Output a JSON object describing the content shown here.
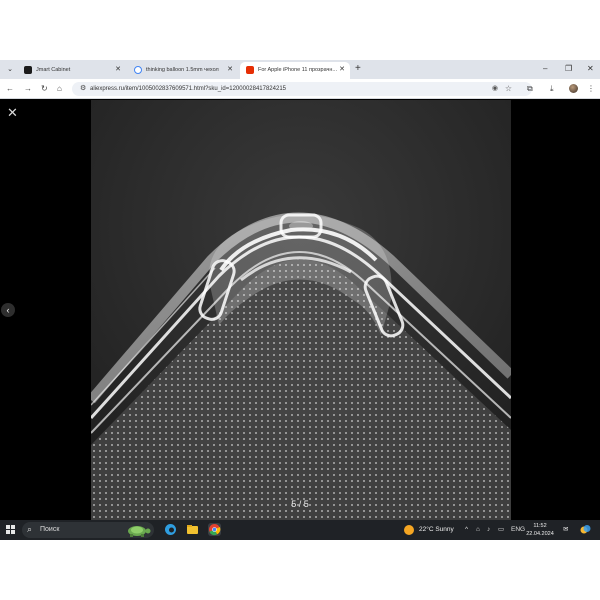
{
  "browser": {
    "tabs": [
      {
        "title": "Jmart Cabinet",
        "favicon_color": "#1b1b1b",
        "active": false
      },
      {
        "title": "thinking balloon 1.5mm чехол",
        "favicon_color": "#4285f4",
        "active": false
      },
      {
        "title": "For Apple iPhone 11 прозрачн...",
        "favicon_color": "#e62e04",
        "active": true
      }
    ],
    "new_tab_glyph": "+",
    "window_controls": {
      "minimize": "–",
      "restore": "❐",
      "close": "✕"
    },
    "url": "aliexpress.ru/item/1005002837609571.html?sku_id=12000028417824215"
  },
  "viewer": {
    "close_glyph": "✕",
    "prev_glyph": "‹",
    "counter": "5 / 5",
    "product_image": "clear silicone phone case corner, dotted back, black background"
  },
  "taskbar": {
    "search_placeholder": "Поиск",
    "weather": "22°C  Sunny",
    "language": "ENG",
    "time": "11:52",
    "date": "22.04.2024",
    "apps": [
      {
        "name": "edge-icon",
        "color": "#2f9ee0"
      },
      {
        "name": "file-explorer-icon",
        "color": "#f2c230"
      },
      {
        "name": "chrome-icon",
        "color": "#e3412f"
      }
    ]
  },
  "colors": {
    "tabbar_bg": "#dfe3ea",
    "taskbar_bg": "#1f2226",
    "viewer_bg": "#000000",
    "accent_red": "#e62e04"
  }
}
